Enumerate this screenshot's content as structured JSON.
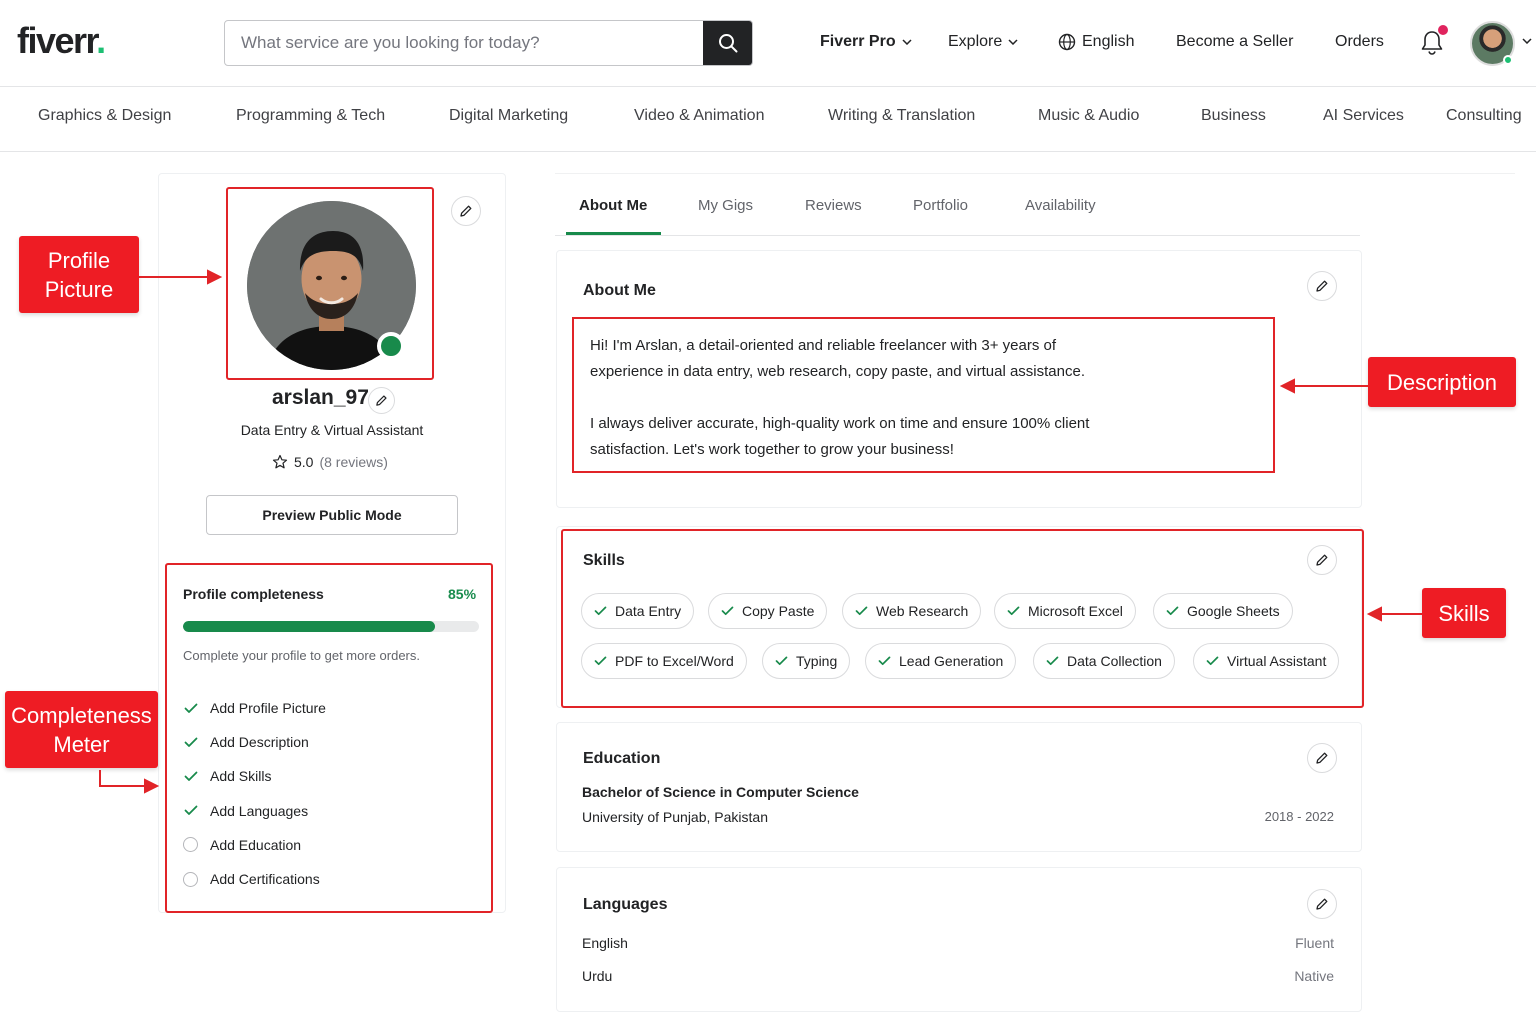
{
  "header": {
    "logo": "fiverr",
    "logo_dot": ".",
    "search_placeholder": "What service are you looking for today?",
    "nav": {
      "fiverr_pro": "Fiverr Pro",
      "explore": "Explore",
      "language": "English",
      "become_seller": "Become a Seller",
      "orders": "Orders"
    }
  },
  "categories": [
    "Graphics & Design",
    "Programming & Tech",
    "Digital Marketing",
    "Video & Animation",
    "Writing & Translation",
    "Music & Audio",
    "Business",
    "AI Services",
    "Consulting"
  ],
  "profile": {
    "username": "arslan_97",
    "tagline": "Data Entry & Virtual Assistant",
    "rating": "5.0",
    "reviews": "(8 reviews)",
    "preview_label": "Preview Public Mode"
  },
  "completeness": {
    "title": "Profile completeness",
    "percent_label": "85%",
    "percent_value": 85,
    "subtitle": "Complete your profile to get more orders.",
    "items": [
      {
        "label": "Add Profile Picture",
        "done": true
      },
      {
        "label": "Add Description",
        "done": true
      },
      {
        "label": "Add Skills",
        "done": true
      },
      {
        "label": "Add Languages",
        "done": true
      },
      {
        "label": "Add Education",
        "done": false
      },
      {
        "label": "Add Certifications",
        "done": false
      }
    ]
  },
  "tabs": [
    "About Me",
    "My Gigs",
    "Reviews",
    "Portfolio",
    "Availability"
  ],
  "about": {
    "title": "About Me",
    "para1_line1": "Hi! I'm Arslan, a detail-oriented and reliable freelancer with 3+ years of",
    "para1_line2": "experience in data entry, web research, copy paste, and virtual assistance.",
    "para2_line1": "I always deliver accurate, high-quality work on time and ensure 100% client",
    "para2_line2": "satisfaction. Let's work together to grow your business!"
  },
  "skills": {
    "title": "Skills",
    "items": [
      "Data Entry",
      "Copy Paste",
      "Web Research",
      "Microsoft Excel",
      "Google Sheets",
      "PDF to Excel/Word",
      "Typing",
      "Lead Generation",
      "Data Collection",
      "Virtual Assistant"
    ]
  },
  "education": {
    "title": "Education",
    "degree": "Bachelor of Science in Computer Science",
    "school": "University of Punjab, Pakistan",
    "years": "2018 - 2022"
  },
  "languages": {
    "title": "Languages",
    "items": [
      {
        "name": "English",
        "level": "Fluent"
      },
      {
        "name": "Urdu",
        "level": "Native"
      }
    ]
  },
  "annotations": {
    "profile_picture_1": "Profile",
    "profile_picture_2": "Picture",
    "description": "Description",
    "skills": "Skills",
    "completeness_1": "Completeness",
    "completeness_2": "Meter"
  },
  "colors": {
    "brand_green": "#1dbf73",
    "accent_green": "#188a4b",
    "annotation_red": "#ee1c24",
    "notification": "#e0245e"
  }
}
